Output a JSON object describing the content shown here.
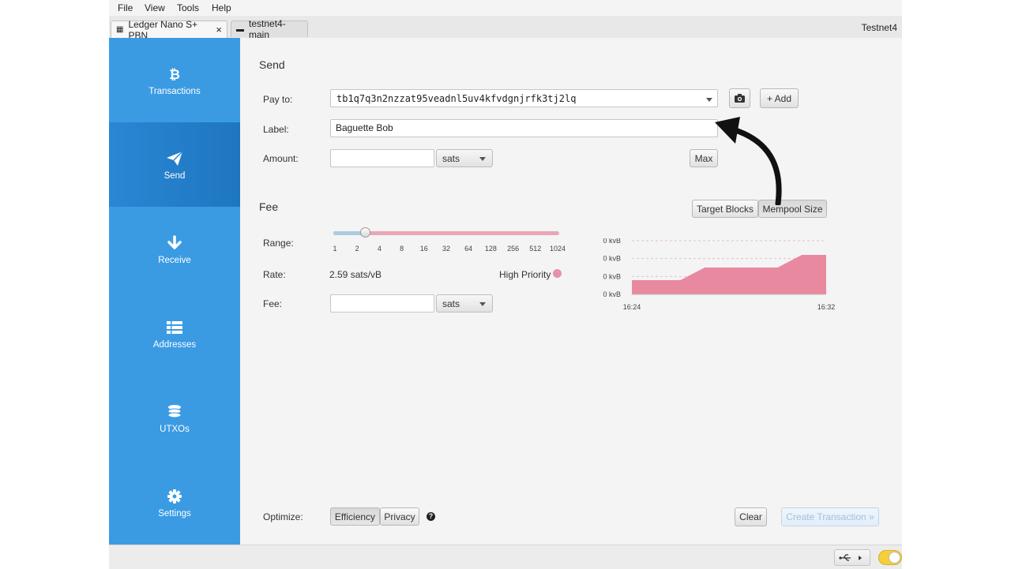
{
  "menu": [
    "File",
    "View",
    "Tools",
    "Help"
  ],
  "tabs": [
    {
      "label": "Ledger Nano S+ PBN",
      "close": "×"
    },
    {
      "label": "testnet4-main"
    }
  ],
  "network": "Testnet4",
  "sidebar": [
    {
      "label": "Transactions",
      "icon": "bitcoin-icon"
    },
    {
      "label": "Send",
      "icon": "paper-plane-icon"
    },
    {
      "label": "Receive",
      "icon": "arrow-down-icon"
    },
    {
      "label": "Addresses",
      "icon": "list-icon"
    },
    {
      "label": "UTXOs",
      "icon": "coins-icon"
    },
    {
      "label": "Settings",
      "icon": "gear-icon"
    }
  ],
  "send": {
    "title": "Send",
    "pay_to_label": "Pay to:",
    "pay_to_value": "tb1q7q3n2nzzat95veadnl5uv4kfvdgnjrfk3tj2lq",
    "add_label": "+ Add",
    "label_label": "Label:",
    "label_value": "Baguette Bob",
    "amount_label": "Amount:",
    "amount_value": "",
    "amount_unit": "sats",
    "max_label": "Max"
  },
  "fee": {
    "title": "Fee",
    "target_blocks_label": "Target Blocks",
    "mempool_size_label": "Mempool Size",
    "range_label": "Range:",
    "range_ticks": [
      "1",
      "2",
      "4",
      "8",
      "16",
      "32",
      "64",
      "128",
      "256",
      "512",
      "1024"
    ],
    "slider_value": 2.59,
    "rate_label": "Rate:",
    "rate_value": "2.59 sats/vB",
    "priority_label": "High Priority",
    "priority_color": "#e891ab",
    "fee_label": "Fee:",
    "fee_value": "",
    "fee_unit": "sats"
  },
  "chart_data": {
    "type": "area",
    "y_tick_labels": [
      "0 kvB",
      "0 kvB",
      "0 kvB",
      "0 kvB"
    ],
    "x_tick_labels": [
      "16:24",
      "16:32"
    ],
    "series": [
      {
        "color": "#e8899f",
        "values": [
          1,
          1,
          1,
          2,
          2,
          2,
          2,
          3,
          3
        ]
      }
    ]
  },
  "footer": {
    "optimize_label": "Optimize:",
    "efficiency_label": "Efficiency",
    "privacy_label": "Privacy",
    "help_icon": "question-icon",
    "clear_label": "Clear",
    "create_label": "Create Transaction »"
  }
}
